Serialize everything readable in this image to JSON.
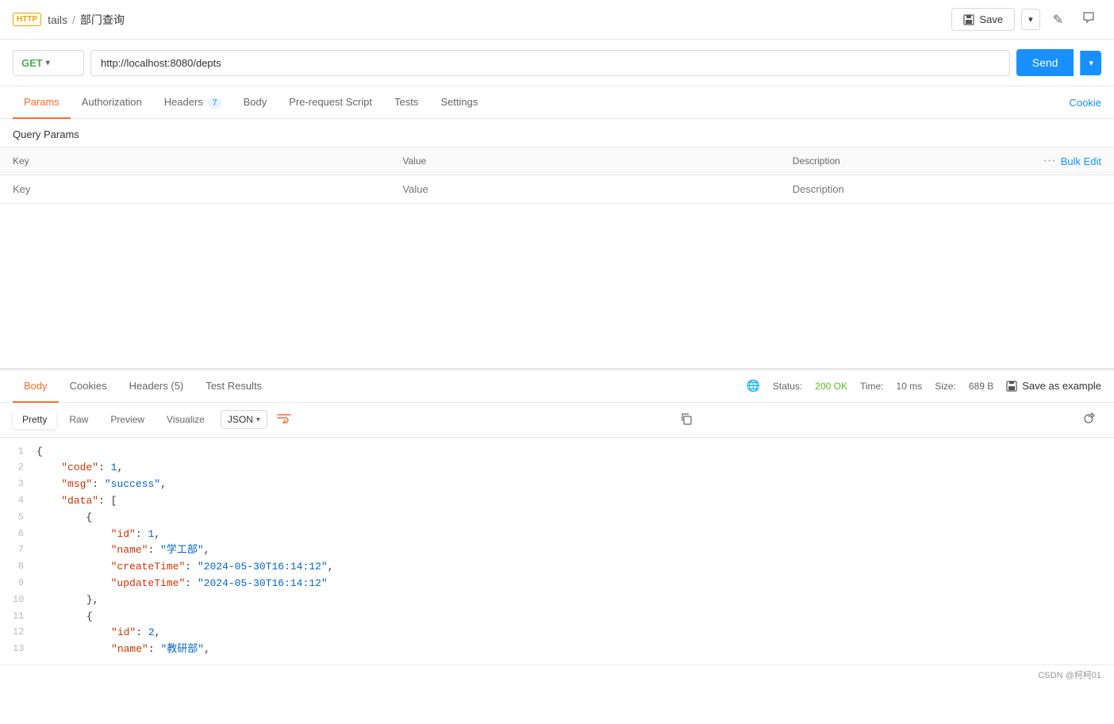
{
  "header": {
    "http_badge": "HTTP",
    "breadcrumb_parent": "tails",
    "breadcrumb_separator": "/",
    "breadcrumb_current": "部门查询",
    "save_label": "Save",
    "edit_icon": "✎",
    "comment_icon": "💬"
  },
  "url_bar": {
    "method": "GET",
    "url": "http://localhost:8080/depts",
    "send_label": "Send"
  },
  "request_tabs": [
    {
      "id": "params",
      "label": "Params",
      "badge": null,
      "active": true
    },
    {
      "id": "authorization",
      "label": "Authorization",
      "badge": null,
      "active": false
    },
    {
      "id": "headers",
      "label": "Headers",
      "badge": "7",
      "active": false
    },
    {
      "id": "body",
      "label": "Body",
      "badge": null,
      "active": false
    },
    {
      "id": "pre-request",
      "label": "Pre-request Script",
      "badge": null,
      "active": false
    },
    {
      "id": "tests",
      "label": "Tests",
      "badge": null,
      "active": false
    },
    {
      "id": "settings",
      "label": "Settings",
      "badge": null,
      "active": false
    }
  ],
  "cookies_link": "Cookie",
  "query_params": {
    "section_title": "Query Params",
    "columns": [
      "Key",
      "Value",
      "Description"
    ],
    "bulk_edit": "Bulk Edit",
    "placeholder_key": "Key",
    "placeholder_value": "Value",
    "placeholder_description": "Description"
  },
  "response_tabs": [
    {
      "id": "body",
      "label": "Body",
      "active": true
    },
    {
      "id": "cookies",
      "label": "Cookies",
      "active": false
    },
    {
      "id": "headers",
      "label": "Headers (5)",
      "active": false
    },
    {
      "id": "test-results",
      "label": "Test Results",
      "active": false
    }
  ],
  "response_status": {
    "status_label": "Status:",
    "status_value": "200 OK",
    "time_label": "Time:",
    "time_value": "10 ms",
    "size_label": "Size:",
    "size_value": "689 B",
    "save_example": "Save as example"
  },
  "format_bar": {
    "tabs": [
      "Pretty",
      "Raw",
      "Preview",
      "Visualize"
    ],
    "active_tab": "Pretty",
    "format": "JSON",
    "wrap_icon": "⇔"
  },
  "json_content": [
    {
      "line": 1,
      "content": "{",
      "type": "brace"
    },
    {
      "line": 2,
      "content": "  \"code\": 1,",
      "key": "code",
      "value": "1"
    },
    {
      "line": 3,
      "content": "  \"msg\": \"success\",",
      "key": "msg",
      "value": "success"
    },
    {
      "line": 4,
      "content": "  \"data\": [",
      "key": "data"
    },
    {
      "line": 5,
      "content": "    {",
      "type": "brace"
    },
    {
      "line": 6,
      "content": "      \"id\": 1,",
      "key": "id",
      "value": "1"
    },
    {
      "line": 7,
      "content": "      \"name\": \"学工部\",",
      "key": "name",
      "value": "学工部"
    },
    {
      "line": 8,
      "content": "      \"createTime\": \"2024-05-30T16:14:12\",",
      "key": "createTime",
      "value": "2024-05-30T16:14:12"
    },
    {
      "line": 9,
      "content": "      \"updateTime\": \"2024-05-30T16:14:12\"",
      "key": "updateTime",
      "value": "2024-05-30T16:14:12"
    },
    {
      "line": 10,
      "content": "    },",
      "type": "brace"
    },
    {
      "line": 11,
      "content": "    {",
      "type": "brace"
    },
    {
      "line": 12,
      "content": "      \"id\": 2,",
      "key": "id",
      "value": "2"
    },
    {
      "line": 13,
      "content": "      \"name\": \"教研部\",",
      "key": "name",
      "value": "教研部"
    }
  ],
  "bottom_bar": {
    "watermark": "CSDN @柯柯01"
  }
}
